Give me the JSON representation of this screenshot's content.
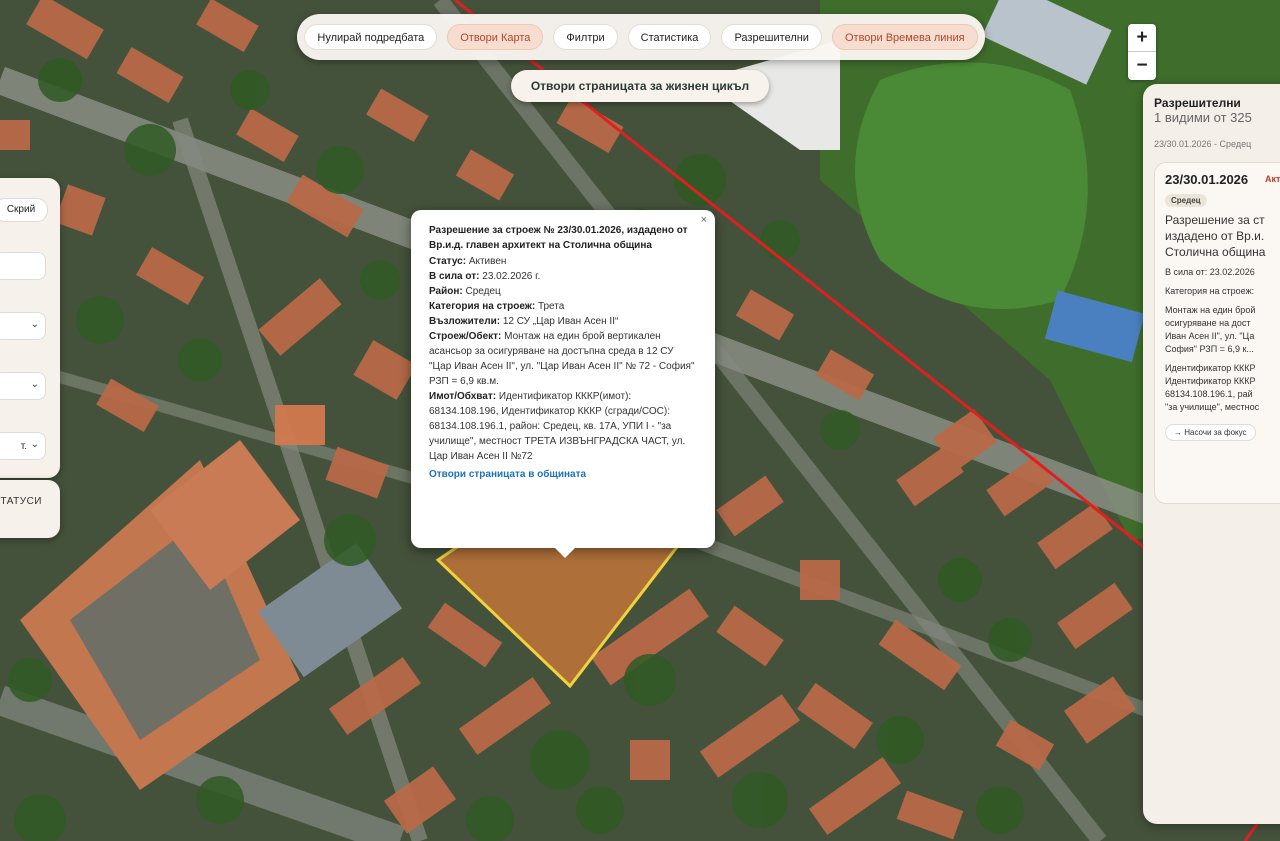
{
  "toolbar": {
    "items": [
      "Нулирай подредбата",
      "Отвори Карта",
      "Филтри",
      "Статистика",
      "Разрешителни",
      "Отвори Времева линия"
    ],
    "lifecycle_label": "Отвори страницата за жизнен цикъл"
  },
  "zoom": {
    "in": "+",
    "out": "−"
  },
  "left_panel": {
    "chip": "Скрий",
    "select_3_text": "т.",
    "statuses_label": "ТАТУСИ"
  },
  "popup": {
    "close": "×",
    "title": "Разрешение за строеж № 23/30.01.2026, издадено от Вр.и.д. главен архитект на Столична община",
    "status_label": "Статус:",
    "status_value": "Активен",
    "effective_label": "В сила от:",
    "effective_value": "23.02.2026 г.",
    "district_label": "Район:",
    "district_value": "Средец",
    "category_label": "Категория на строеж:",
    "category_value": "Трета",
    "assignors_label": "Възложители:",
    "assignors_value": "12 СУ „Цар Иван Асен II“",
    "building_label": "Строеж/Обект:",
    "building_value": "Монтаж на един брой вертикален асансьор за осигуряване на достъпна среда в 12 СУ \"Цар Иван Асен II\", ул. \"Цар Иван Асен II\" № 72 - София\" РЗП = 6,9 кв.м.",
    "property_label": "Имот/Обхват:",
    "property_value": "Идентификатор КККР(имот): 68134.108.196, Идентификатор КККР (сгради/СОС): 68134.108.196.1, район: Средец, кв. 17А, УПИ I - \"за училище\", местност ТРЕТА ИЗВЪНГРАДСКА ЧАСТ, ул. Цар Иван Асен II №72",
    "link": "Отвори страницата в общината"
  },
  "right_panel": {
    "title": "Разрешителни",
    "count": "1 видими от 325",
    "filter_summary": "23/30.01.2026 - Средец",
    "card": {
      "number": "23/30.01.2026",
      "status": "Акт",
      "district": "Средец",
      "title_lines": [
        "Разрешение за ст",
        "издадено от Вр.и.",
        "Столична община"
      ],
      "effective": "В сила от: 23.02.2026",
      "category": "Категория на строеж:",
      "desc_lines": [
        "Монтаж на един брой",
        "осигуряване на дост",
        "Иван Асен II\", ул. \"Ца",
        "София\" РЗП = 6,9 к..."
      ],
      "id_lines": [
        "Идентификатор КККР",
        "Идентификатор КККР",
        "68134.108.196.1, рай",
        "\"за училище\", местнос"
      ],
      "focus_button": "→ Насочи за фокус"
    }
  },
  "colors": {
    "accent": "#b0472c",
    "accent_bg": "#f6ddd0",
    "link": "#1b73b6",
    "parcel_fill": "#d2793a",
    "parcel_outline": "#f0d23c",
    "boundary": "#e02020"
  }
}
